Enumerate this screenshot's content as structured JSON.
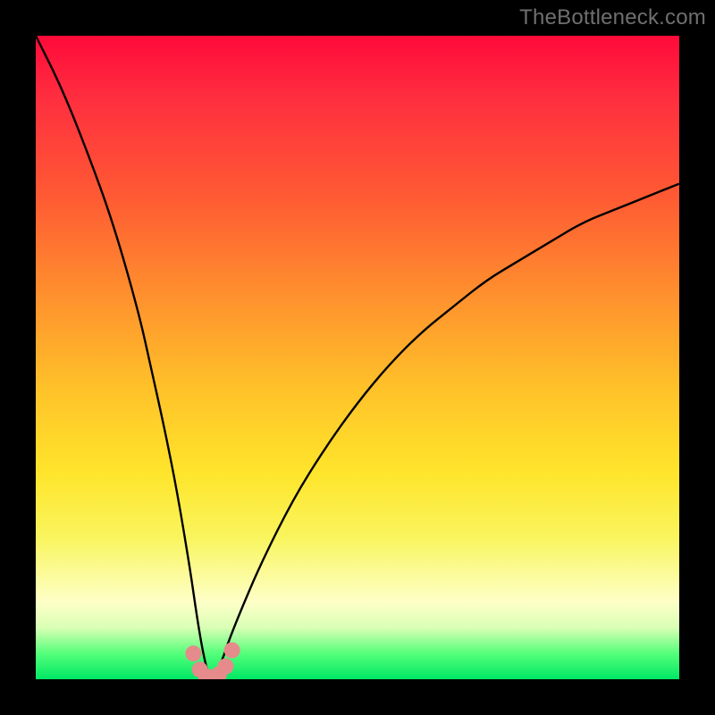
{
  "watermark": "TheBottleneck.com",
  "chart_data": {
    "type": "line",
    "title": "",
    "xlabel": "",
    "ylabel": "",
    "x_range": [
      0,
      100
    ],
    "y_range": [
      0,
      100
    ],
    "notes": "Qualitative bottleneck curve over a red-to-green vertical gradient. Y≈100 is worst (red), Y≈0 is best (green). The curve has a sharp minimum near x≈27 reaching y≈0, and rises steeply on both sides.",
    "series": [
      {
        "name": "bottleneck-curve",
        "color": "#000000",
        "x": [
          0,
          4,
          8,
          12,
          16,
          18,
          20,
          22,
          24,
          25,
          26,
          27,
          28,
          29,
          30,
          32,
          35,
          40,
          45,
          50,
          55,
          60,
          65,
          70,
          75,
          80,
          85,
          90,
          95,
          100
        ],
        "y": [
          100,
          92,
          82,
          71,
          57,
          48,
          39,
          29,
          17,
          10,
          4,
          0,
          1,
          3,
          6,
          11,
          18,
          28,
          36,
          43,
          49,
          54,
          58,
          62,
          65,
          68,
          71,
          73,
          75,
          77
        ]
      },
      {
        "name": "trough-markers",
        "color": "#e58b8b",
        "type": "scatter",
        "x": [
          24.5,
          25.5,
          26.5,
          27.5,
          28.5,
          29.5,
          30.5
        ],
        "y": [
          4.0,
          1.5,
          0.4,
          0.3,
          0.8,
          2.0,
          4.5
        ]
      }
    ]
  },
  "colors": {
    "frame": "#000000",
    "curve": "#000000",
    "markers": "#e58b8b",
    "watermark": "#6f6f6f"
  }
}
